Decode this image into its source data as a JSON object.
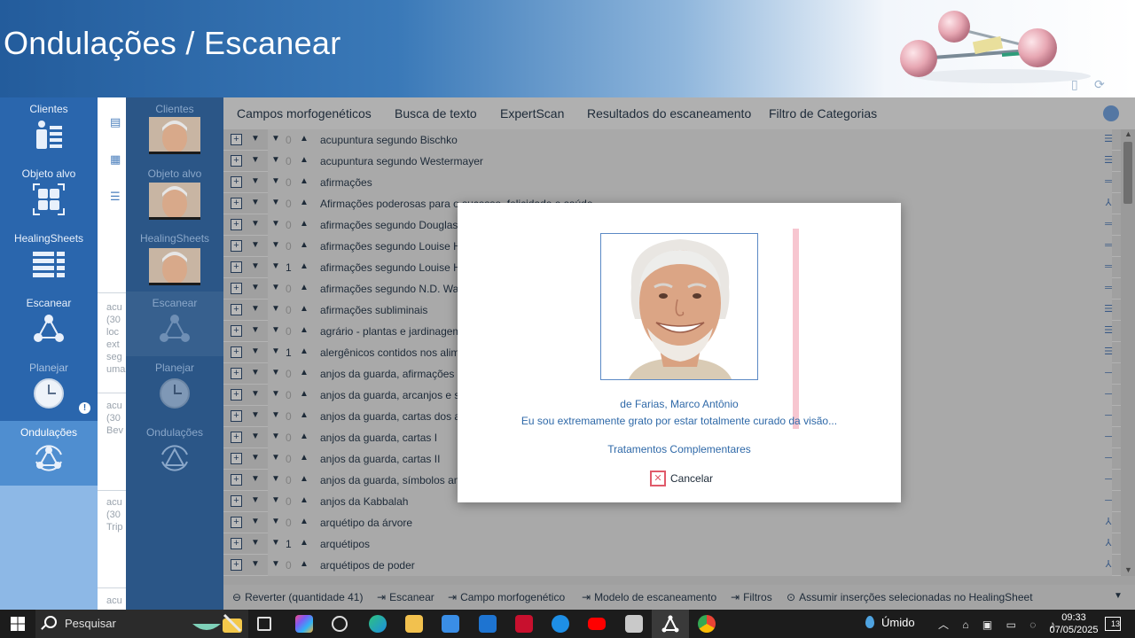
{
  "header": {
    "title": "Ondulações / Escanear"
  },
  "left_nav": {
    "items": [
      {
        "label": "Clientes",
        "icon": "clients-icon"
      },
      {
        "label": "Objeto alvo",
        "icon": "target-object-icon"
      },
      {
        "label": "HealingSheets",
        "icon": "healingsheets-icon"
      },
      {
        "label": "Escanear",
        "icon": "scan-icon"
      },
      {
        "label": "Planejar",
        "icon": "clock-icon"
      },
      {
        "label": "Ondulações",
        "icon": "waves-icon"
      }
    ]
  },
  "side_snippets": [
    {
      "lines": [
        "acu",
        "(30",
        "loc",
        "ext",
        "seg",
        "uma"
      ]
    },
    {
      "lines": [
        "acu",
        "(30",
        "Bev"
      ]
    },
    {
      "lines": [
        "acu",
        "(30",
        "Trip"
      ]
    },
    {
      "lines": [
        "acu"
      ]
    }
  ],
  "tabs": [
    "Campos morfogenéticos",
    "Busca de texto",
    "ExpertScan",
    "Resultados do escaneamento",
    "Filtro de Categorias"
  ],
  "rows": [
    {
      "num": "0",
      "text": "acupuntura segundo Bischko"
    },
    {
      "num": "0",
      "text": "acupuntura segundo Westermayer"
    },
    {
      "num": "0",
      "text": "afirmações"
    },
    {
      "num": "0",
      "text": "Afirmações poderosas para o sucesso, felicidade e saúde"
    },
    {
      "num": "0",
      "text": "afirmações segundo Douglas Bloch"
    },
    {
      "num": "0",
      "text": "afirmações segundo Louise Hay"
    },
    {
      "num": "1",
      "text": "afirmações segundo Louise Hay (doenças)"
    },
    {
      "num": "0",
      "text": "afirmações segundo N.D. Walsch"
    },
    {
      "num": "0",
      "text": "afirmações subliminais"
    },
    {
      "num": "0",
      "text": "agrário - plantas e jardinagem"
    },
    {
      "num": "1",
      "text": "alergênicos contidos nos alimentos"
    },
    {
      "num": "0",
      "text": "anjos da guarda, afirmações"
    },
    {
      "num": "0",
      "text": "anjos da guarda, arcanjos e serafins"
    },
    {
      "num": "0",
      "text": "anjos da guarda, cartas dos anjos"
    },
    {
      "num": "0",
      "text": "anjos da guarda, cartas I"
    },
    {
      "num": "0",
      "text": "anjos da guarda, cartas II"
    },
    {
      "num": "0",
      "text": "anjos da guarda, símbolos angelicais"
    },
    {
      "num": "0",
      "text": "anjos da Kabbalah"
    },
    {
      "num": "0",
      "text": "arquétipo da árvore"
    },
    {
      "num": "1",
      "text": "arquétipos"
    },
    {
      "num": "0",
      "text": "arquétipos de poder"
    }
  ],
  "bottom_bar": [
    "Reverter (quantidade 41)",
    "Escanear",
    "Campo morfogenético",
    "Modelo de escaneamento",
    "Filtros",
    "Assumir inserções selecionadas no HealingSheet"
  ],
  "modal": {
    "name": "de Farias, Marco Antônio",
    "message": "Eu sou extremamente grato por estar totalmente curado da visão...",
    "link": "Tratamentos Complementares",
    "cancel_label": "Cancelar"
  },
  "taskbar": {
    "search_placeholder": "Pesquisar",
    "weather": "Úmido",
    "time": "09:33",
    "date": "07/05/2025",
    "notifications": "13"
  },
  "colors": {
    "header_blue": "#235c9c",
    "nav_blue": "#2a66ad",
    "nav_active": "#4f8ed0",
    "link_blue": "#2f69a8",
    "cancel_red": "#e05a6a"
  }
}
